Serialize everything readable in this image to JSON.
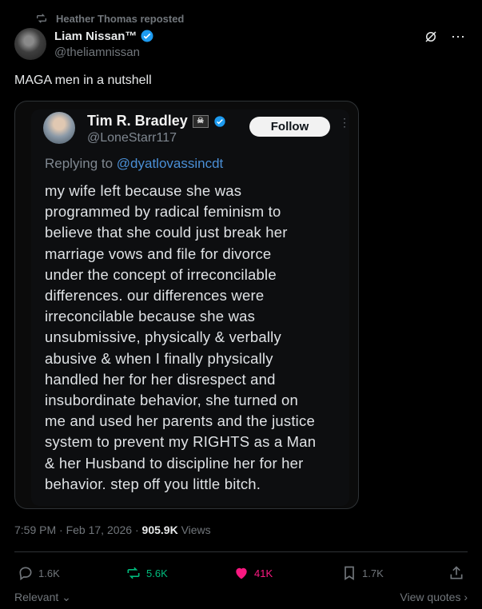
{
  "repost": {
    "text": "Heather Thomas reposted"
  },
  "author": {
    "name": "Liam Nissan™",
    "handle": "@theliamnissan"
  },
  "tweet": {
    "text": "MAGA men in a nutshell"
  },
  "embedded": {
    "name": "Tim R. Bradley",
    "handle": "@LoneStarr117",
    "follow_label": "Follow",
    "replying_prefix": "Replying to",
    "replying_handle": "@dyatlovassincdt",
    "lines": [
      "my wife left because she was",
      "programmed by radical feminism to",
      "believe that she could just break her",
      "marriage vows and file for divorce",
      "under the concept of irreconcilable",
      "differences. our differences were",
      "irreconcilable because she was",
      "unsubmissive, physically & verbally",
      "abusive & when I finally physically",
      "handled her for her disrespect and",
      "insubordinate behavior, she turned on",
      "me and used her parents and the justice",
      "system to prevent my RIGHTS as a Man",
      "& her Husband to discipline her for her",
      "behavior. step off you little bitch."
    ]
  },
  "meta": {
    "time": "7:59 PM · Feb 17, 2026 · ",
    "views_count": "905.9K",
    "views_label": " Views"
  },
  "actions": {
    "replies": "1.6K",
    "reposts": "5.6K",
    "likes": "41K",
    "bookmarks": "1.7K"
  },
  "footer": {
    "relevant": "Relevant",
    "view_quotes": "View quotes"
  },
  "colors": {
    "repost": "#00ba7c",
    "like": "#f91880",
    "verified": "#1d9bf0"
  }
}
